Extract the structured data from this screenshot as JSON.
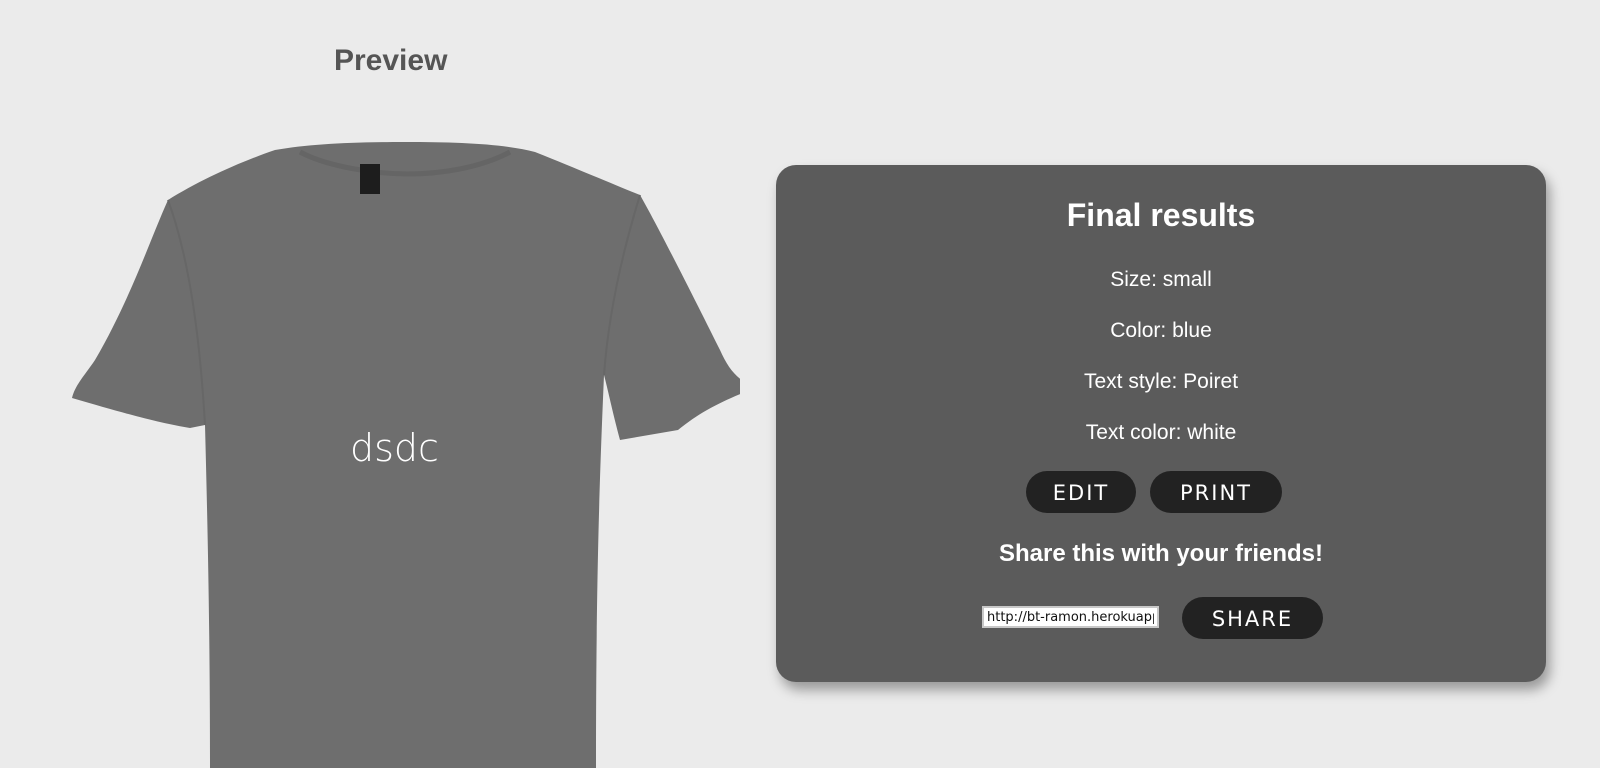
{
  "preview": {
    "title": "Preview",
    "shirt_text": "dsdc",
    "shirt_color": "#6e6e6e",
    "shirt_text_color": "#ffffff"
  },
  "results": {
    "title": "Final results",
    "size_line": "Size: small",
    "color_line": "Color: blue",
    "text_style_line": "Text style: Poiret",
    "text_color_line": "Text color: white",
    "edit_label": "EDIT",
    "print_label": "PRINT",
    "share_title": "Share this with your friends!",
    "share_url": "http://bt-ramon.herokuapp.com",
    "share_label": "SHARE"
  },
  "colors": {
    "background": "#ebebeb",
    "card": "#5b5b5b",
    "button": "#222222"
  }
}
